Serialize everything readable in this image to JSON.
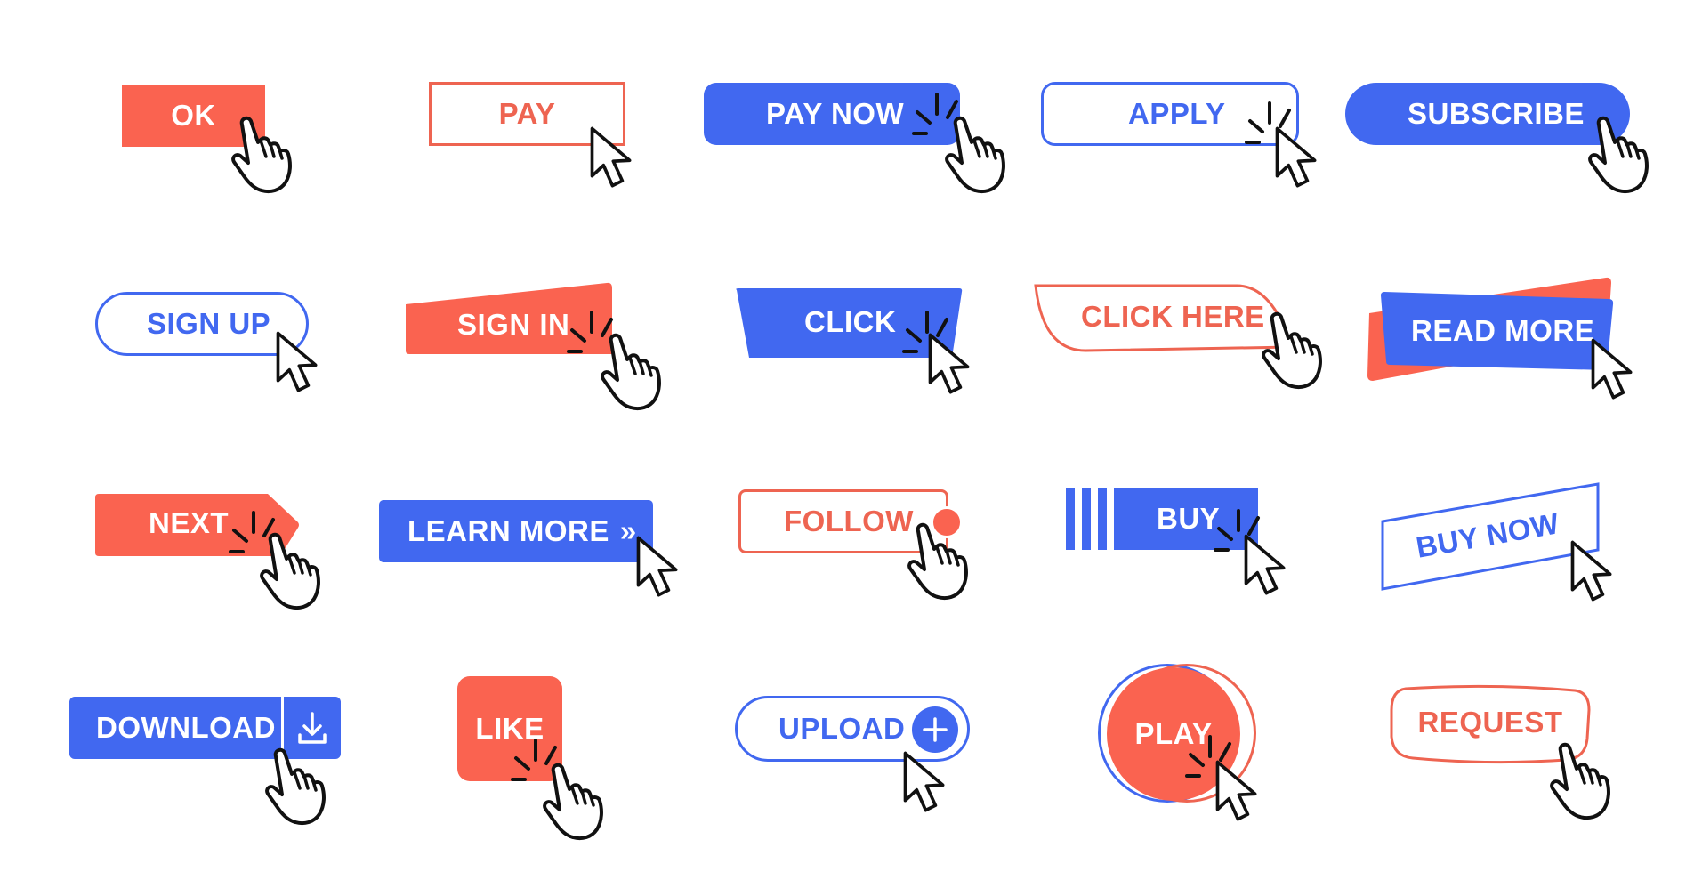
{
  "colors": {
    "blue": "#4168F0",
    "coral": "#FA6350",
    "coral_outline": "#EE6451",
    "cursor_stroke": "#111111",
    "background": "#FFFFFF"
  },
  "buttons": [
    {
      "id": "ok",
      "label": "OK",
      "style": "coral-fill",
      "cursor": "hand-pointer-icon"
    },
    {
      "id": "pay",
      "label": "PAY",
      "style": "coral-outline",
      "cursor": "arrow-pointer-icon"
    },
    {
      "id": "pay-now",
      "label": "PAY NOW",
      "style": "blue-fill-rounded",
      "cursor": "hand-pointer-icon",
      "click_lines": true
    },
    {
      "id": "apply",
      "label": "APPLY",
      "style": "blue-outline-rounded",
      "cursor": "arrow-pointer-icon",
      "click_lines": true
    },
    {
      "id": "subscribe",
      "label": "SUBSCRIBE",
      "style": "blue-fill-pill",
      "cursor": "hand-pointer-icon"
    },
    {
      "id": "sign-up",
      "label": "SIGN UP",
      "style": "blue-outline-pill",
      "cursor": "arrow-pointer-icon"
    },
    {
      "id": "sign-in",
      "label": "SIGN IN",
      "style": "coral-fill-slanted",
      "cursor": "hand-pointer-icon",
      "click_lines": true
    },
    {
      "id": "click",
      "label": "CLICK",
      "style": "blue-fill-trapezoid",
      "cursor": "arrow-pointer-icon",
      "click_lines": true
    },
    {
      "id": "click-here",
      "label": "CLICK HERE",
      "style": "coral-outline-leaf",
      "cursor": "hand-pointer-icon"
    },
    {
      "id": "read-more",
      "label": "READ MORE",
      "style": "blue-fill-layered-coral",
      "cursor": "arrow-pointer-icon"
    },
    {
      "id": "next",
      "label": "NEXT",
      "style": "coral-fill-arrow-tag",
      "cursor": "hand-pointer-icon",
      "click_lines": true
    },
    {
      "id": "learn-more",
      "label": "LEARN MORE",
      "icon": "»",
      "style": "blue-fill",
      "cursor": "arrow-pointer-icon"
    },
    {
      "id": "follow",
      "label": "FOLLOW",
      "style": "coral-outline-dot",
      "cursor": "hand-pointer-icon"
    },
    {
      "id": "buy",
      "label": "BUY",
      "style": "blue-fill-stripes",
      "cursor": "arrow-pointer-icon",
      "click_lines": true
    },
    {
      "id": "buy-now",
      "label": "BUY NOW",
      "style": "blue-outline-tilted",
      "cursor": "arrow-pointer-icon"
    },
    {
      "id": "download",
      "label": "DOWNLOAD",
      "icon": "download-icon",
      "style": "blue-fill-split",
      "cursor": "hand-pointer-icon"
    },
    {
      "id": "like",
      "label": "LIKE",
      "style": "coral-fill-square",
      "cursor": "hand-pointer-icon",
      "click_lines": true
    },
    {
      "id": "upload",
      "label": "UPLOAD",
      "icon": "plus-icon",
      "style": "blue-outline-pill-plus",
      "cursor": "arrow-pointer-icon"
    },
    {
      "id": "play",
      "label": "PLAY",
      "style": "coral-fill-circle-offset",
      "cursor": "arrow-pointer-icon",
      "click_lines": true
    },
    {
      "id": "request",
      "label": "REQUEST",
      "style": "coral-outline-blob",
      "cursor": "hand-pointer-icon"
    }
  ]
}
